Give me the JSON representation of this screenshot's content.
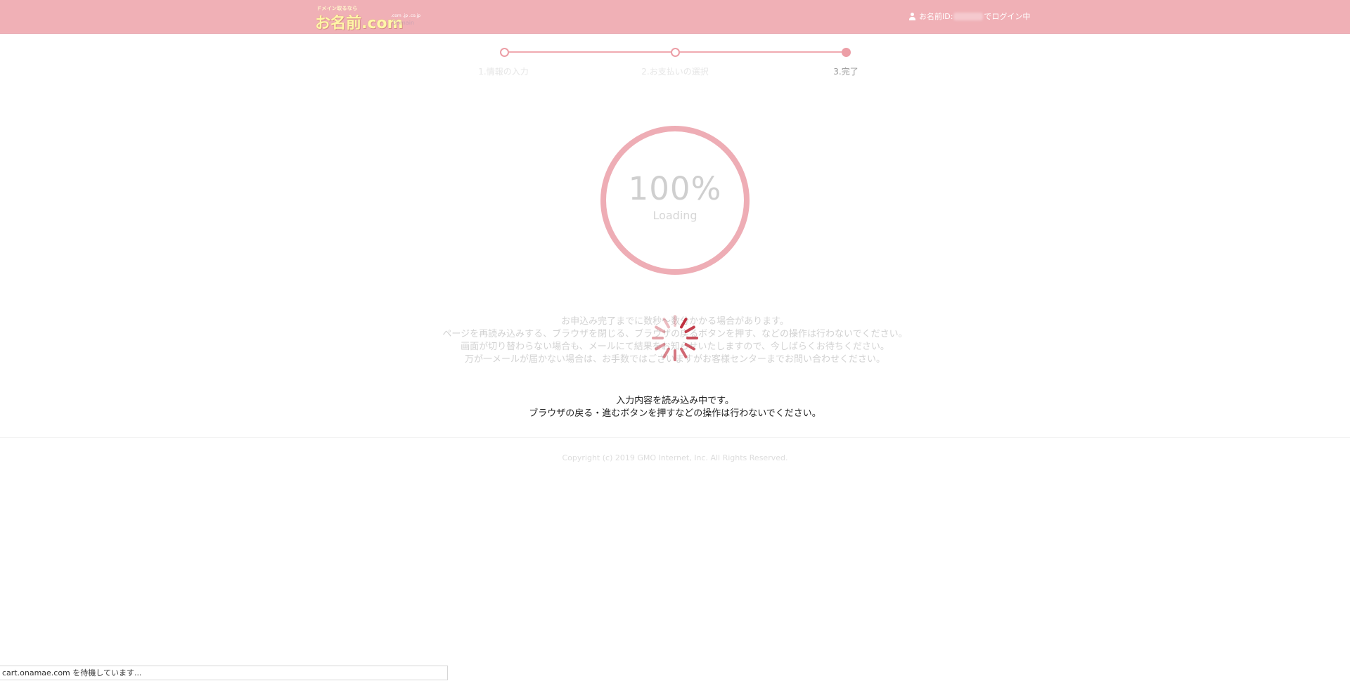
{
  "header": {
    "logo": {
      "tagline": "ドメイン取るなら",
      "text": "お名前.com",
      "tlds": ".com .jp .co.jp",
      "sub": "Domain"
    },
    "login": {
      "prefix": "お名前ID:",
      "suffix": "でログイン中"
    }
  },
  "steps": [
    {
      "label": "1.情報の入力",
      "state": "done"
    },
    {
      "label": "2.お支払いの選択",
      "state": "done"
    },
    {
      "label": "3.完了",
      "state": "active"
    }
  ],
  "progress": {
    "percent_text": "100%",
    "value": 1.0,
    "label": "Loading"
  },
  "notice": [
    "お申込み完了までに数秒〜数分かかる場合があります。",
    "ページを再読み込みする、ブラウザを閉じる、ブラウザの戻るボタンを押す、などの操作は行わないでください。",
    "画面が切り替わらない場合も、メールにて結果をお知らせいたしますので、今しばらくお待ちください。",
    "万が一メールが届かない場合は、お手数ではございますがお客様センターまでお問い合わせください。"
  ],
  "loading_message": [
    "入力内容を読み込み中です。",
    "ブラウザの戻る・進むボタンを押すなどの操作は行わないでください。"
  ],
  "footer": {
    "copyright": "Copyright (c) 2019 GMO Internet, Inc. All Rights Reserved."
  },
  "status_bar": {
    "text": "cart.onamae.com を待機しています..."
  },
  "colors": {
    "header_bg": "#f0b0b6",
    "accent": "#ec9ea6",
    "spinner": "#c0303f"
  },
  "icons": {
    "user": "user-icon",
    "spinner": "spinner-icon"
  }
}
